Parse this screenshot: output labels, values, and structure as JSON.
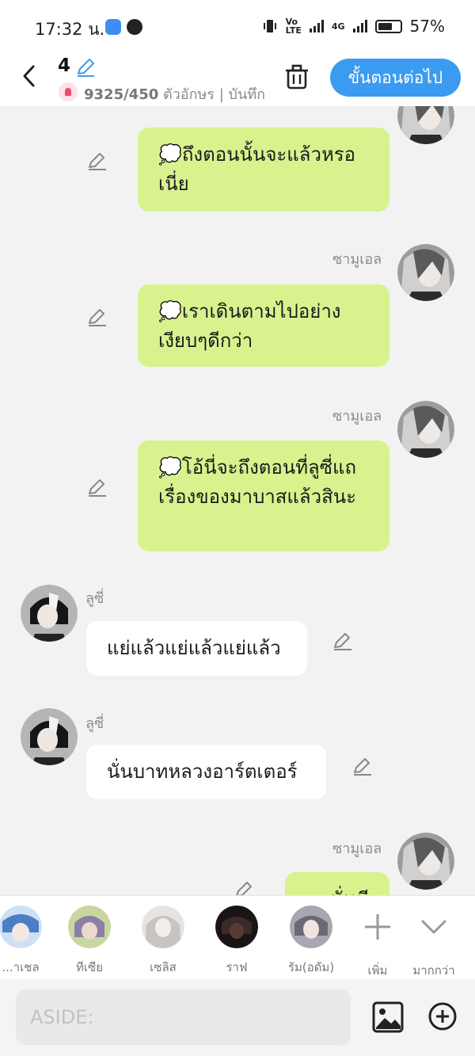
{
  "status": {
    "time": "17:32 น.",
    "net_small_1": "Vo\nLTE",
    "net_small_2": "4G",
    "battery": "57%"
  },
  "header": {
    "episode": "4",
    "char_count": "9325/450",
    "char_count_suffix": " ตัวอักษร | บันทึก",
    "next_button": "ขั้นตอนต่อไป"
  },
  "messages": [
    {
      "side": "right",
      "speaker": "",
      "text": "💭ถึงตอนนั้นจะแล้วหรอเนี่ย"
    },
    {
      "side": "right",
      "speaker": "ซามูเอล",
      "text": "💭เราเดินตามไปอย่างเงียบๆดีกว่า"
    },
    {
      "side": "right",
      "speaker": "ซามูเอล",
      "text": "💭โอ้นี่จะถึงตอนที่ลูซี่แถเรื่องของมาบาสแล้วสินะ"
    },
    {
      "side": "left",
      "speaker": "ลูซี่",
      "text": "แย่แล้วแย่แล้วแย่แล้ว"
    },
    {
      "side": "left",
      "speaker": "ลูซี่",
      "text": "นั่นบาทหลวงอาร์ตเตอร์"
    },
    {
      "side": "right",
      "speaker": "ซามูเอล",
      "text": "...นั่นมี"
    }
  ],
  "characters": [
    {
      "label": "...าเชล",
      "color": "#5b8fd6"
    },
    {
      "label": "ทีเซีย",
      "color": "#8b7fa8"
    },
    {
      "label": "เซลิส",
      "color": "#c9c4c0"
    },
    {
      "label": "ราฟ",
      "color": "#2a1f1f"
    },
    {
      "label": "รัม(อดัม)",
      "color": "#7e7a86"
    }
  ],
  "char_actions": {
    "add": "เพิ่ม",
    "more": "มากกว่า"
  },
  "composer": {
    "placeholder": "ASIDE:"
  },
  "colors": {
    "accent": "#3a9bf0",
    "my_bubble": "#d8f28e",
    "other_bubble": "#ffffff"
  }
}
